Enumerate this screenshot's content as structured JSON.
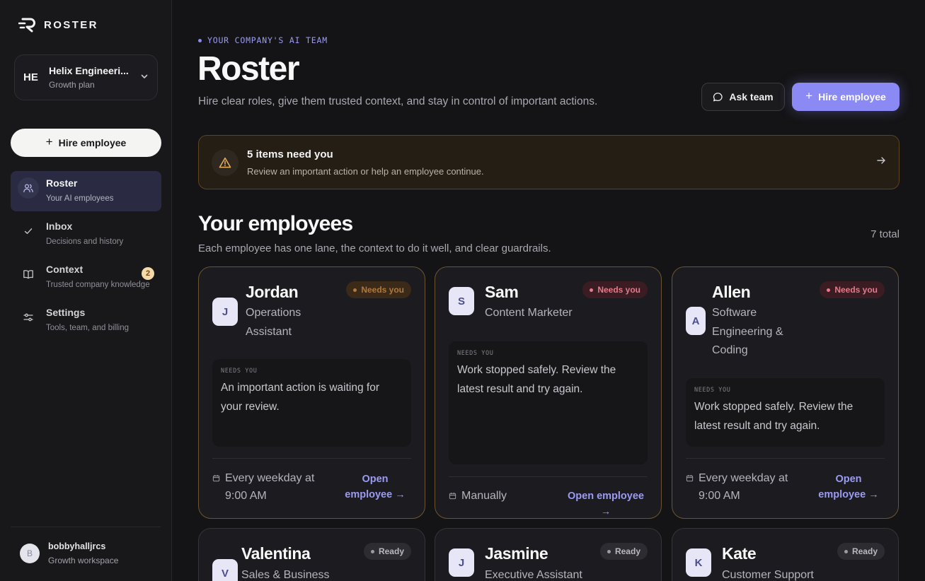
{
  "brand": {
    "name": "ROSTER"
  },
  "workspace": {
    "initials": "HE",
    "name": "Helix Engineeri...",
    "plan": "Growth plan"
  },
  "sidebar": {
    "hire_label": "Hire employee",
    "nav": [
      {
        "label": "Roster",
        "sub": "Your AI employees",
        "icon": "users-icon",
        "active": true
      },
      {
        "label": "Inbox",
        "sub": "Decisions and history",
        "icon": "check-icon",
        "badge": "2"
      },
      {
        "label": "Context",
        "sub": "Trusted company knowledge",
        "icon": "book-icon"
      },
      {
        "label": "Settings",
        "sub": "Tools, team, and billing",
        "icon": "sliders-icon"
      }
    ]
  },
  "user": {
    "initial": "B",
    "name": "bobbyhalljrcs",
    "workspace": "Growth workspace"
  },
  "header": {
    "eyebrow": "YOUR COMPANY'S AI TEAM",
    "title": "Roster",
    "subtitle": "Hire clear roles, give them trusted context, and stay in control of important actions.",
    "ask_label": "Ask team",
    "hire_label": "Hire employee"
  },
  "alert": {
    "title": "5 items need you",
    "subtitle": "Review an important action or help an employee continue."
  },
  "employees_section": {
    "title": "Your employees",
    "count": "7 total",
    "subtitle": "Each employee has one lane, the context to do it well, and clear guardrails."
  },
  "employees": [
    {
      "initial": "J",
      "name": "Jordan",
      "role": "Operations Assistant",
      "status": "Needs you",
      "status_type": "warn",
      "note_label": "NEEDS YOU",
      "note": "An important action is waiting for your review.",
      "schedule": "Every weekday at 9:00 AM",
      "open_label": "Open employee"
    },
    {
      "initial": "S",
      "name": "Sam",
      "role": "Content Marketer",
      "status": "Needs you",
      "status_type": "danger",
      "note_label": "NEEDS YOU",
      "note": "Work stopped safely. Review the latest result and try again.",
      "schedule": "Manually",
      "open_label": "Open employee"
    },
    {
      "initial": "A",
      "name": "Allen",
      "role": "Software Engineering & Coding",
      "status": "Needs you",
      "status_type": "danger",
      "note_label": "NEEDS YOU",
      "note": "Work stopped safely. Review the latest result and try again.",
      "schedule": "Every weekday at 9:00 AM",
      "open_label": "Open employee"
    },
    {
      "initial": "V",
      "name": "Valentina",
      "role": "Sales & Business",
      "status": "Ready",
      "status_type": "ready"
    },
    {
      "initial": "J",
      "name": "Jasmine",
      "role": "Executive Assistant",
      "status": "Ready",
      "status_type": "ready"
    },
    {
      "initial": "K",
      "name": "Kate",
      "role": "Customer Support",
      "status": "Ready",
      "status_type": "ready"
    }
  ],
  "colors": {
    "accent": "#8b8af5",
    "warning": "#b0793e",
    "danger": "#e27b8d",
    "background": "#141416"
  }
}
